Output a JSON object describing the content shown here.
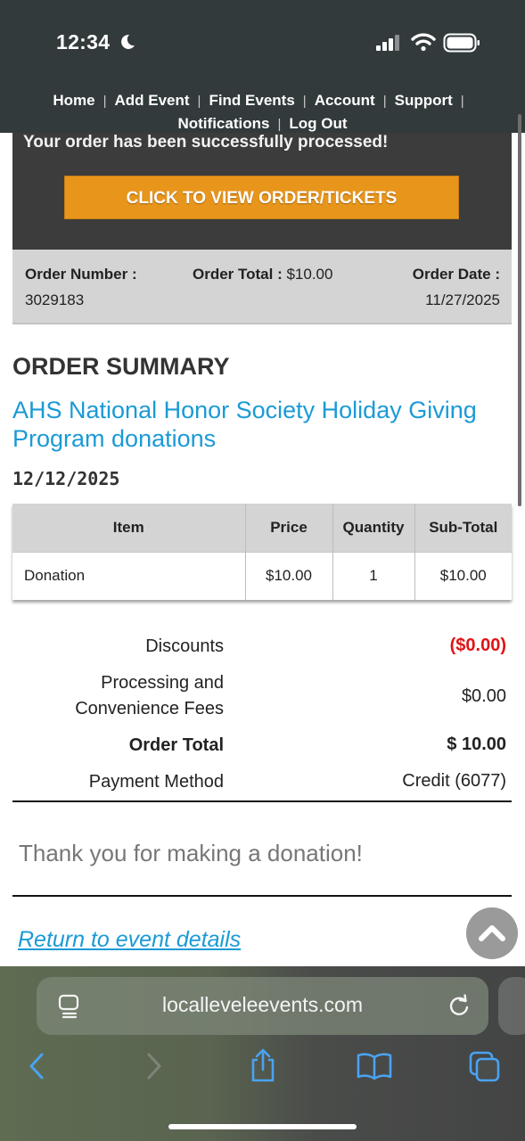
{
  "status_bar": {
    "time": "12:34"
  },
  "nav": {
    "items": [
      "Home",
      "Add Event",
      "Find Events",
      "Account",
      "Support",
      "Notifications",
      "Log Out"
    ],
    "separator": "|"
  },
  "banner": {
    "message": "Your order has been successfully processed!",
    "button_label": "CLICK TO VIEW ORDER/TICKETS"
  },
  "order_info": {
    "number_label": "Order Number :",
    "number_value": "3029183",
    "total_label": "Order Total :",
    "total_value": " $10.00",
    "date_label": "Order Date :",
    "date_value": "11/27/2025"
  },
  "summary": {
    "heading": "ORDER SUMMARY",
    "event_title": "AHS National Honor Society Holiday Giving Program donations",
    "event_date": "12/12/2025"
  },
  "table": {
    "headers": [
      "Item",
      "Price",
      "Quantity",
      "Sub-Total"
    ],
    "rows": [
      [
        "Donation",
        "$10.00",
        "1",
        "$10.00"
      ]
    ]
  },
  "totals": {
    "discounts_label": "Discounts",
    "discounts_value": "($0.00)",
    "fees_label_line1": "Processing and",
    "fees_label_line2": "Convenience Fees",
    "fees_value": "$0.00",
    "order_total_label": "Order Total",
    "order_total_value": "$ 10.00",
    "payment_label": "Payment Method",
    "payment_value": "Credit (6077)"
  },
  "thanks_message": "Thank you for making a donation!",
  "return_link": "Return to event details",
  "browser": {
    "url": "localleveleevents.com"
  },
  "colors": {
    "accent_blue": "#1b9ad6",
    "button_orange": "#e8951c",
    "discount_red": "#e01414",
    "nav_dark": "#323a3c"
  },
  "icons": [
    "moon-icon",
    "signal-icon",
    "wifi-icon",
    "battery-icon",
    "chevron-up-icon",
    "page-menu-icon",
    "reload-icon",
    "back-icon",
    "forward-icon",
    "share-icon",
    "bookmarks-icon",
    "tabs-icon"
  ]
}
